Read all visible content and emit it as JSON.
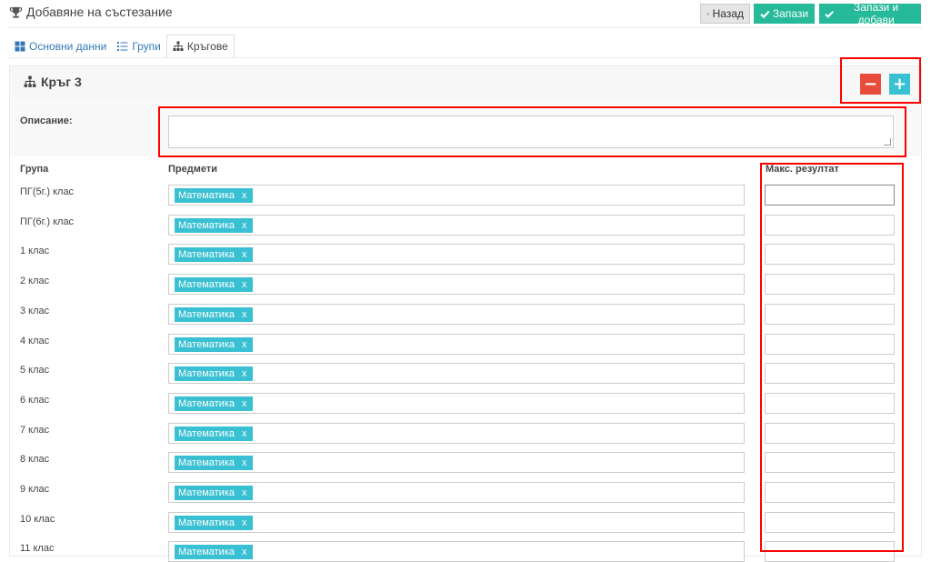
{
  "header": {
    "title": "Добавяне на състезание",
    "back_label": "Назад",
    "save_label": "Запази",
    "save_add_label": "Запази и добави"
  },
  "tabs": [
    {
      "label": "Основни данни",
      "icon": "grid-icon"
    },
    {
      "label": "Групи",
      "icon": "list-icon"
    },
    {
      "label": "Кръгове",
      "icon": "sitemap-icon",
      "active": true
    }
  ],
  "round": {
    "title": "Кръг 3",
    "description_label": "Описание:",
    "description_value": ""
  },
  "columns": {
    "group": "Група",
    "subjects": "Предмети",
    "max_result": "Макс. резултат"
  },
  "rows": [
    {
      "group": "ПГ(5г.) клас",
      "subject": "Математика",
      "max": ""
    },
    {
      "group": "ПГ(6г.) клас",
      "subject": "Математика",
      "max": ""
    },
    {
      "group": "1 клас",
      "subject": "Математика",
      "max": ""
    },
    {
      "group": "2 клас",
      "subject": "Математика",
      "max": ""
    },
    {
      "group": "3 клас",
      "subject": "Математика",
      "max": ""
    },
    {
      "group": "4 клас",
      "subject": "Математика",
      "max": ""
    },
    {
      "group": "5 клас",
      "subject": "Математика",
      "max": ""
    },
    {
      "group": "6 клас",
      "subject": "Математика",
      "max": ""
    },
    {
      "group": "7 клас",
      "subject": "Математика",
      "max": ""
    },
    {
      "group": "8 клас",
      "subject": "Математика",
      "max": ""
    },
    {
      "group": "9 клас",
      "subject": "Математика",
      "max": ""
    },
    {
      "group": "10 клас",
      "subject": "Математика",
      "max": ""
    },
    {
      "group": "11 клас",
      "subject": "Математика",
      "max": ""
    }
  ],
  "tag_remove": "x",
  "colors": {
    "accent": "#26b99a",
    "tag": "#39c0d2",
    "danger": "#e74c3c",
    "highlight": "#ff0000"
  }
}
